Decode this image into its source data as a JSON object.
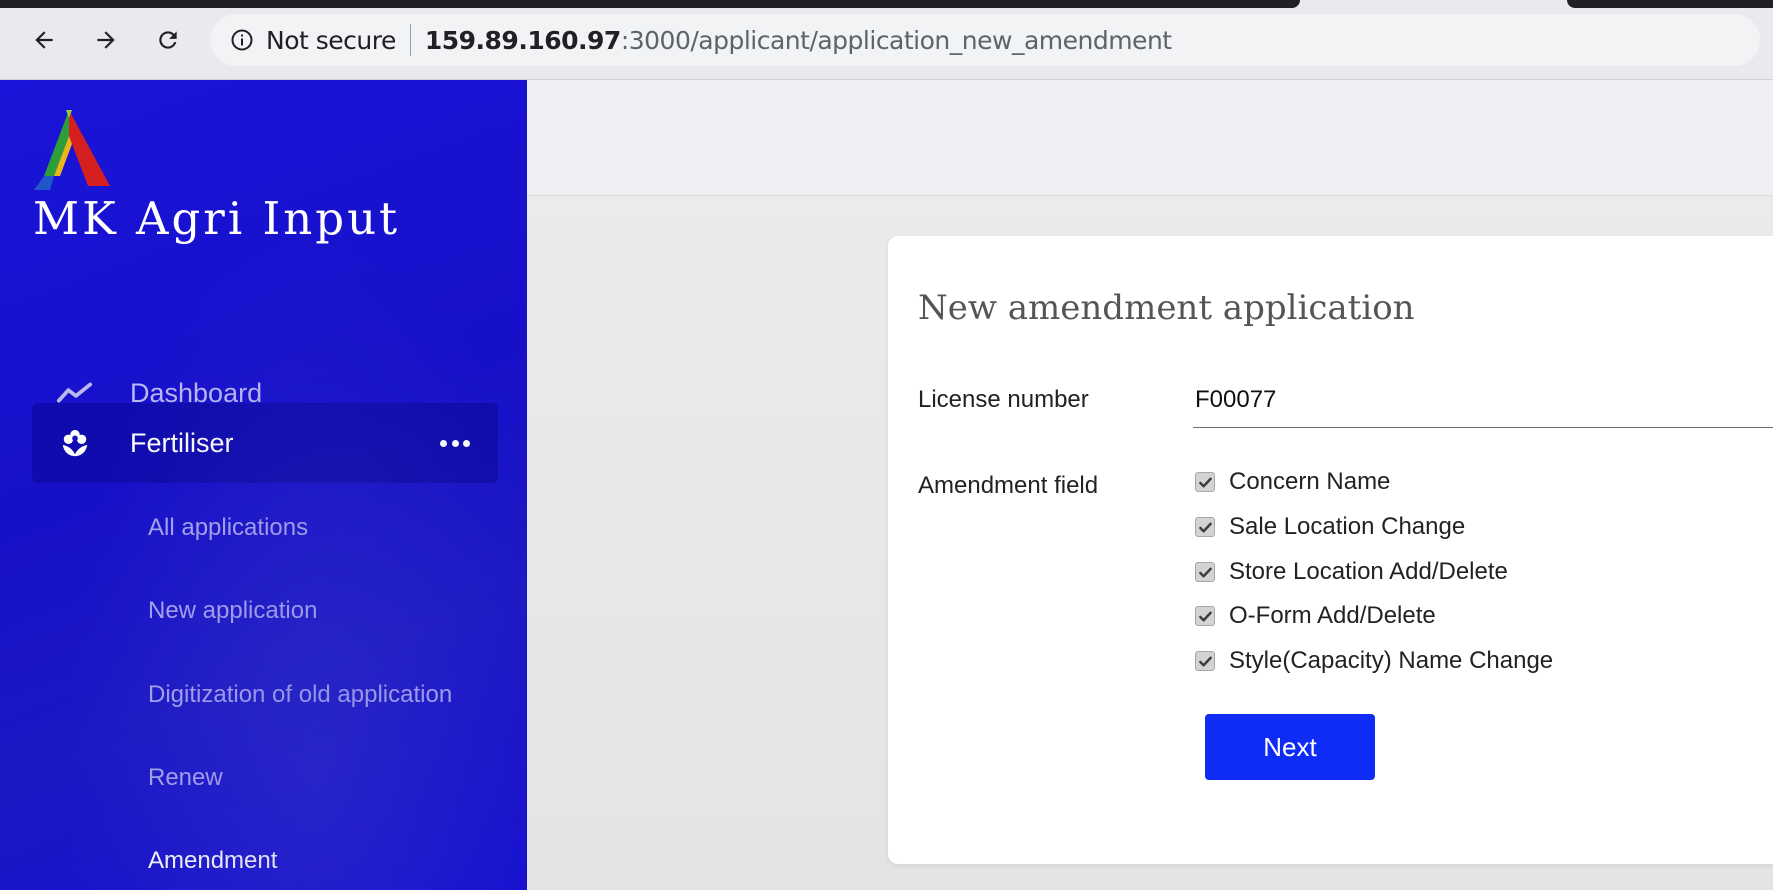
{
  "browser": {
    "security_label": "Not secure",
    "url_host": "159.89.160.97",
    "url_path": ":3000/applicant/application_new_amendment"
  },
  "sidebar": {
    "brand": "MK Agri Input",
    "items": [
      {
        "label": "Dashboard",
        "icon": "activity-line-icon"
      },
      {
        "label": "Fertiliser",
        "icon": "flower-icon"
      }
    ],
    "sub_items": [
      {
        "label": "All applications"
      },
      {
        "label": "New application"
      },
      {
        "label": "Digitization of old application"
      },
      {
        "label": "Renew"
      },
      {
        "label": "Amendment",
        "active": true
      }
    ]
  },
  "form": {
    "title": "New amendment application",
    "license_label": "License number",
    "license_value": "F00077",
    "amendment_label": "Amendment field",
    "options": [
      {
        "label": "Concern Name",
        "checked": true
      },
      {
        "label": "Sale Location Change",
        "checked": true
      },
      {
        "label": "Store Location Add/Delete",
        "checked": true
      },
      {
        "label": "O-Form Add/Delete",
        "checked": true
      },
      {
        "label": "Style(Capacity) Name Change",
        "checked": true
      }
    ],
    "next_label": "Next"
  },
  "colors": {
    "sidebar": "#1a14d8",
    "primary_button": "#0f2bf6",
    "topbar": "#eff0f3"
  }
}
